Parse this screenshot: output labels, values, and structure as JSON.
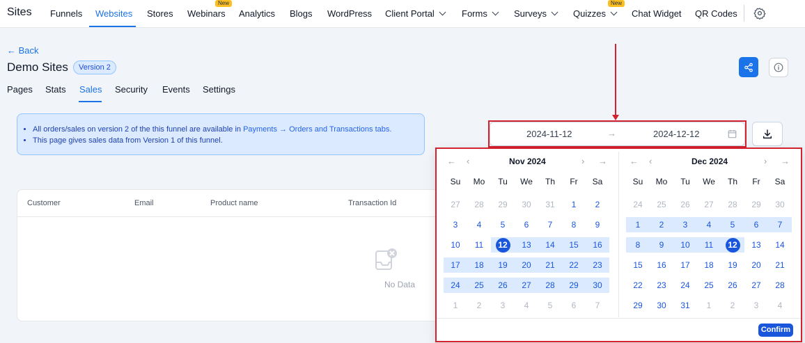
{
  "app": {
    "brand": "Sites"
  },
  "nav": {
    "items": [
      {
        "label": "Funnels"
      },
      {
        "label": "Websites"
      },
      {
        "label": "Stores"
      },
      {
        "label": "Webinars",
        "badge": "New"
      },
      {
        "label": "Analytics"
      },
      {
        "label": "Blogs"
      },
      {
        "label": "WordPress"
      },
      {
        "label": "Client Portal"
      },
      {
        "label": "Forms"
      },
      {
        "label": "Surveys"
      },
      {
        "label": "Quizzes",
        "badge": "New"
      },
      {
        "label": "Chat Widget"
      },
      {
        "label": "QR Codes"
      }
    ],
    "active": "Websites",
    "settings_icon": "gear-icon"
  },
  "header": {
    "back_label": "← Back",
    "title": "Demo Sites",
    "version_badge": "Version 2"
  },
  "tabs": [
    {
      "label": "Pages"
    },
    {
      "label": "Stats"
    },
    {
      "label": "Sales"
    },
    {
      "label": "Security"
    },
    {
      "label": "Events"
    },
    {
      "label": "Settings"
    }
  ],
  "active_tab": "Sales",
  "notice": {
    "line1_prefix": "All orders/sales on version 2 of the this funnel are available in ",
    "line1_link": "Payments → Orders and Transactions tabs.",
    "line2": "This page gives sales data from Version 1 of this funnel."
  },
  "date_range": {
    "start": "2024-11-12",
    "end": "2024-12-12",
    "separator": "→"
  },
  "table": {
    "columns": [
      "Customer",
      "Email",
      "Product name",
      "Transaction Id"
    ],
    "empty_text": "No Data"
  },
  "picker": {
    "weekdays": [
      "Su",
      "Mo",
      "Tu",
      "We",
      "Th",
      "Fr",
      "Sa"
    ],
    "nav": {
      "prev_year": "←",
      "prev_month": "‹",
      "next_month": "›",
      "next_year": "→"
    },
    "months": [
      {
        "title": "Nov 2024",
        "weeks": [
          [
            [
              "27",
              "out"
            ],
            [
              "28",
              "out"
            ],
            [
              "29",
              "out"
            ],
            [
              "30",
              "out"
            ],
            [
              "31",
              "out"
            ],
            [
              "1",
              "in"
            ],
            [
              "2",
              "in"
            ]
          ],
          [
            [
              "3",
              "in"
            ],
            [
              "4",
              "in"
            ],
            [
              "5",
              "in"
            ],
            [
              "6",
              "in"
            ],
            [
              "7",
              "in"
            ],
            [
              "8",
              "in"
            ],
            [
              "9",
              "in"
            ]
          ],
          [
            [
              "10",
              "in"
            ],
            [
              "11",
              "in"
            ],
            [
              "12",
              "selected"
            ],
            [
              "13",
              "range"
            ],
            [
              "14",
              "range"
            ],
            [
              "15",
              "range"
            ],
            [
              "16",
              "range"
            ]
          ],
          [
            [
              "17",
              "range"
            ],
            [
              "18",
              "range"
            ],
            [
              "19",
              "range"
            ],
            [
              "20",
              "range"
            ],
            [
              "21",
              "range"
            ],
            [
              "22",
              "range"
            ],
            [
              "23",
              "range"
            ]
          ],
          [
            [
              "24",
              "range"
            ],
            [
              "25",
              "range"
            ],
            [
              "26",
              "range"
            ],
            [
              "27",
              "range"
            ],
            [
              "28",
              "range"
            ],
            [
              "29",
              "range"
            ],
            [
              "30",
              "range"
            ]
          ],
          [
            [
              "1",
              "out"
            ],
            [
              "2",
              "out"
            ],
            [
              "3",
              "out"
            ],
            [
              "4",
              "out"
            ],
            [
              "5",
              "out"
            ],
            [
              "6",
              "out"
            ],
            [
              "7",
              "out"
            ]
          ]
        ]
      },
      {
        "title": "Dec 2024",
        "weeks": [
          [
            [
              "24",
              "out"
            ],
            [
              "25",
              "out"
            ],
            [
              "26",
              "out"
            ],
            [
              "27",
              "out"
            ],
            [
              "28",
              "out"
            ],
            [
              "29",
              "out"
            ],
            [
              "30",
              "out"
            ]
          ],
          [
            [
              "1",
              "range"
            ],
            [
              "2",
              "range"
            ],
            [
              "3",
              "range"
            ],
            [
              "4",
              "range"
            ],
            [
              "5",
              "range"
            ],
            [
              "6",
              "range"
            ],
            [
              "7",
              "range"
            ]
          ],
          [
            [
              "8",
              "range"
            ],
            [
              "9",
              "range"
            ],
            [
              "10",
              "range"
            ],
            [
              "11",
              "range"
            ],
            [
              "12",
              "selected"
            ],
            [
              "13",
              "in"
            ],
            [
              "14",
              "in"
            ]
          ],
          [
            [
              "15",
              "in"
            ],
            [
              "16",
              "in"
            ],
            [
              "17",
              "in"
            ],
            [
              "18",
              "in"
            ],
            [
              "19",
              "in"
            ],
            [
              "20",
              "in"
            ],
            [
              "21",
              "in"
            ]
          ],
          [
            [
              "22",
              "in"
            ],
            [
              "23",
              "in"
            ],
            [
              "24",
              "in"
            ],
            [
              "25",
              "in"
            ],
            [
              "26",
              "in"
            ],
            [
              "27",
              "in"
            ],
            [
              "28",
              "in"
            ]
          ],
          [
            [
              "29",
              "in"
            ],
            [
              "30",
              "in"
            ],
            [
              "31",
              "in"
            ],
            [
              "1",
              "out"
            ],
            [
              "2",
              "out"
            ],
            [
              "3",
              "out"
            ],
            [
              "4",
              "out"
            ]
          ]
        ]
      }
    ],
    "confirm_label": "Confirm"
  },
  "colors": {
    "accent": "#1a73e8",
    "selected_day": "#1a56db",
    "range_fill": "#dbeafe",
    "annotation": "#d3212d",
    "new_badge": "#fbbf24"
  }
}
